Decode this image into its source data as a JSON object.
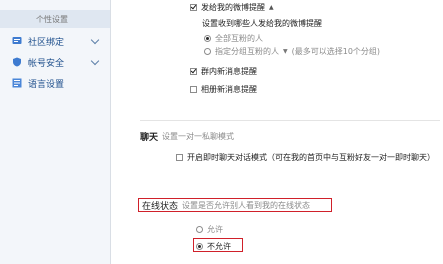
{
  "sidebar": {
    "active_label": "个性设置",
    "items": [
      {
        "label": "社区绑定",
        "icon": "link-icon"
      },
      {
        "label": "帐号安全",
        "icon": "shield-icon"
      },
      {
        "label": "语言设置",
        "icon": "language-icon"
      }
    ]
  },
  "notifications": {
    "weibo_remind_label": "发给我的微博提醒",
    "remind_question": "设置收到哪些人发给我的微博提醒",
    "option_all": "全部互粉的人",
    "option_group": "指定分组互粉的人",
    "option_group_hint": "(最多可以选择10个分组)",
    "group_msg_label": "群内新消息提醒",
    "album_msg_label": "相册新消息提醒"
  },
  "chat": {
    "title": "聊天",
    "subtitle": "设置一对一私聊模式",
    "option_label": "开启即时聊天对话模式（可在我的首页中与互粉好友一对一即时聊天）"
  },
  "online_status": {
    "title": "在线状态",
    "subtitle": "设置是否允许别人看到我的在线状态",
    "allow": "允许",
    "disallow": "不允许"
  },
  "colors": {
    "highlight_red": "#d0202a",
    "sidebar_bg": "#f3f6fa",
    "link_blue": "#1e4f8c"
  }
}
